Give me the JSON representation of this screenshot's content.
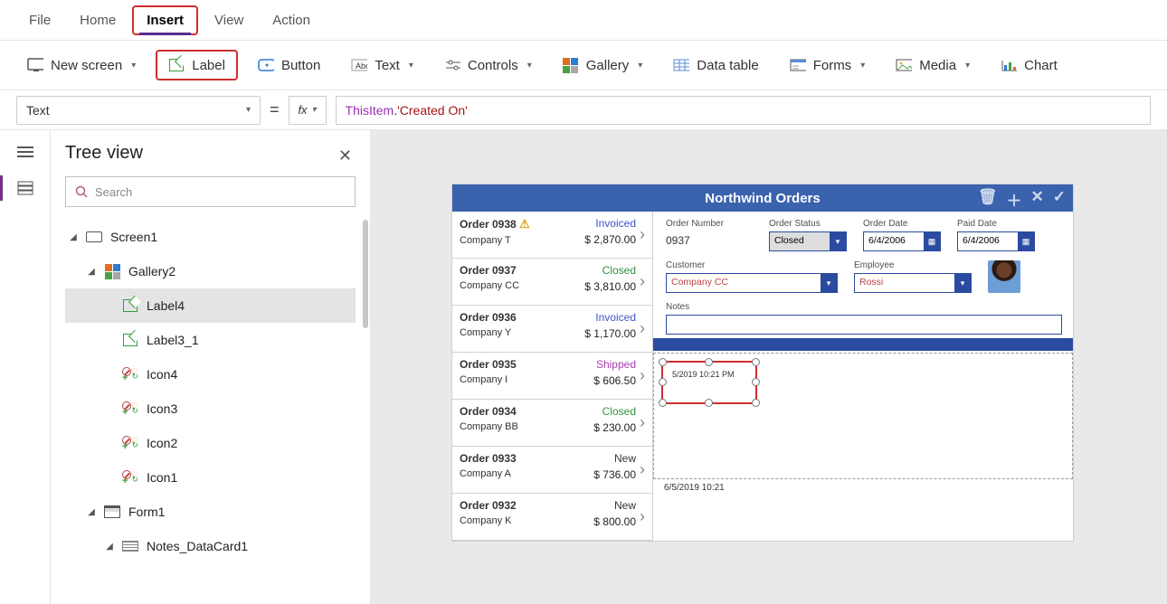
{
  "menu": {
    "file": "File",
    "home": "Home",
    "insert": "Insert",
    "view": "View",
    "action": "Action"
  },
  "ribbon": {
    "new_screen": "New screen",
    "label": "Label",
    "button": "Button",
    "text": "Text",
    "controls": "Controls",
    "gallery": "Gallery",
    "datatable": "Data table",
    "forms": "Forms",
    "media": "Media",
    "chart": "Chart"
  },
  "formula": {
    "property": "Text",
    "fx": "fx",
    "token_id": "ThisItem",
    "dot": ".",
    "token_str": "'Created On'"
  },
  "treepane": {
    "title": "Tree view",
    "search_placeholder": "Search",
    "nodes": {
      "screen": "Screen1",
      "gallery": "Gallery2",
      "label4": "Label4",
      "label3_1": "Label3_1",
      "icon4": "Icon4",
      "icon3": "Icon3",
      "icon2": "Icon2",
      "icon1": "Icon1",
      "form1": "Form1",
      "notes_card": "Notes_DataCard1"
    }
  },
  "app": {
    "title": "Northwind Orders",
    "fields": {
      "order_number_label": "Order Number",
      "order_number": "0937",
      "order_status_label": "Order Status",
      "order_status": "Closed",
      "order_date_label": "Order Date",
      "order_date": "6/4/2006",
      "paid_date_label": "Paid Date",
      "paid_date": "6/4/2006",
      "customer_label": "Customer",
      "customer": "Company CC",
      "employee_label": "Employee",
      "employee": "Rossi",
      "notes_label": "Notes"
    },
    "selected_label_text": "5/2019 10:21 PM",
    "timestamp": "6/5/2019 10:21",
    "orders": [
      {
        "title": "Order 0938",
        "warn": true,
        "company": "Company T",
        "status": "Invoiced",
        "status_class": "st-invoiced",
        "amount": "$ 2,870.00"
      },
      {
        "title": "Order 0937",
        "warn": false,
        "company": "Company CC",
        "status": "Closed",
        "status_class": "st-closed",
        "amount": "$ 3,810.00"
      },
      {
        "title": "Order 0936",
        "warn": false,
        "company": "Company Y",
        "status": "Invoiced",
        "status_class": "st-invoiced",
        "amount": "$ 1,170.00"
      },
      {
        "title": "Order 0935",
        "warn": false,
        "company": "Company I",
        "status": "Shipped",
        "status_class": "st-shipped",
        "amount": "$ 606.50"
      },
      {
        "title": "Order 0934",
        "warn": false,
        "company": "Company BB",
        "status": "Closed",
        "status_class": "st-closed",
        "amount": "$ 230.00"
      },
      {
        "title": "Order 0933",
        "warn": false,
        "company": "Company A",
        "status": "New",
        "status_class": "st-new",
        "amount": "$ 736.00"
      },
      {
        "title": "Order 0932",
        "warn": false,
        "company": "Company K",
        "status": "New",
        "status_class": "st-new",
        "amount": "$ 800.00"
      }
    ]
  }
}
